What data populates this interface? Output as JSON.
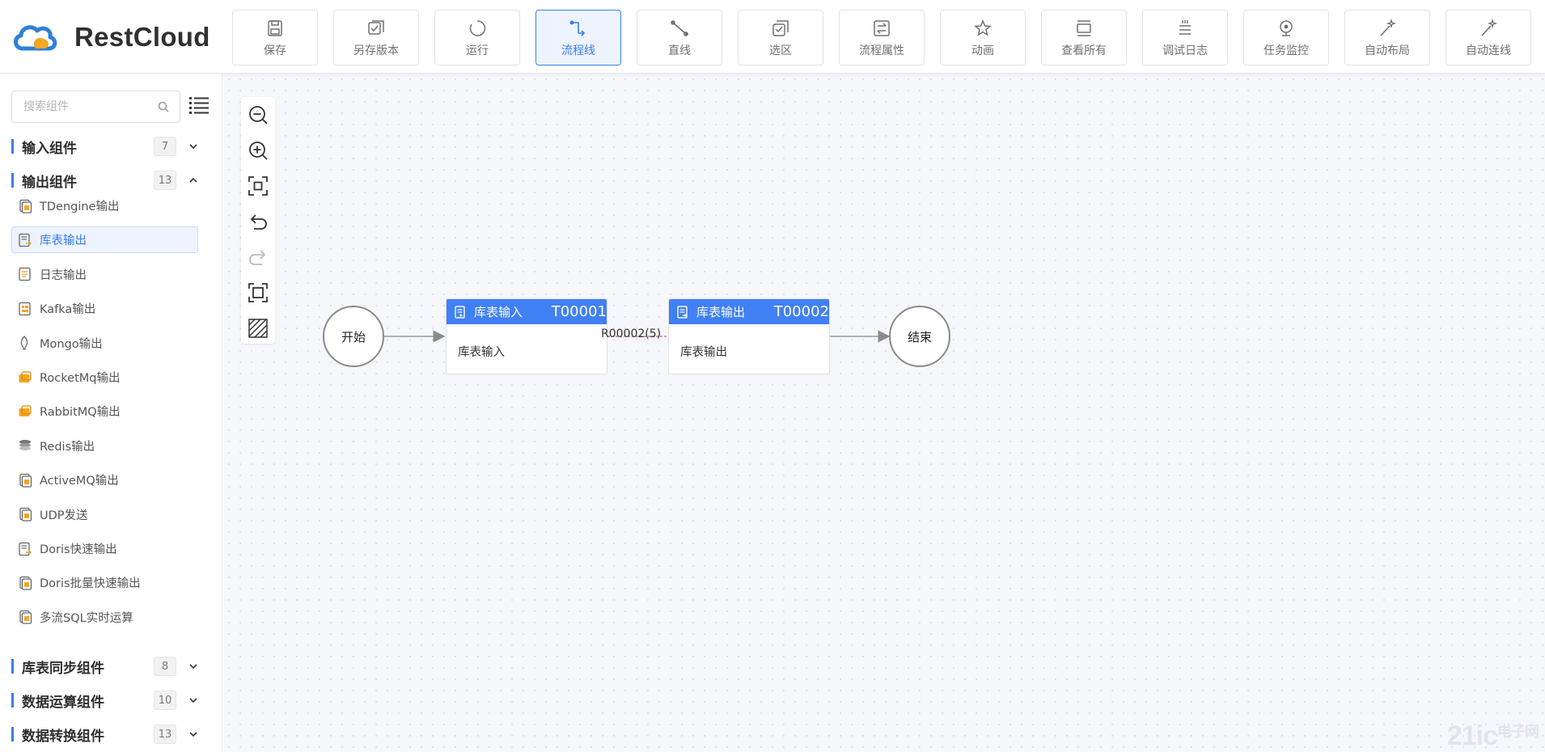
{
  "app": {
    "logo_text": "RestCloud",
    "brand_color": "#3b7cf2"
  },
  "toolbar": [
    {
      "label": "保存",
      "icon": "save-icon"
    },
    {
      "label": "另存版本",
      "icon": "save-version-icon"
    },
    {
      "label": "运行",
      "icon": "run-icon"
    },
    {
      "label": "流程线",
      "icon": "flow-line-icon",
      "active": true
    },
    {
      "label": "直线",
      "icon": "straight-line-icon"
    },
    {
      "label": "选区",
      "icon": "selection-icon"
    },
    {
      "label": "流程属性",
      "icon": "flow-properties-icon"
    },
    {
      "label": "动画",
      "icon": "animation-icon"
    },
    {
      "label": "查看所有",
      "icon": "view-all-icon"
    },
    {
      "label": "调试日志",
      "icon": "debug-log-icon"
    },
    {
      "label": "任务监控",
      "icon": "task-monitor-icon"
    },
    {
      "label": "自动布局",
      "icon": "auto-layout-icon"
    },
    {
      "label": "自动连线",
      "icon": "auto-connect-icon"
    }
  ],
  "sidebar": {
    "search_placeholder": "搜索组件",
    "categories": [
      {
        "label": "输入组件",
        "count": "7",
        "expanded": false
      },
      {
        "label": "输出组件",
        "count": "13",
        "expanded": true
      },
      {
        "label": "库表同步组件",
        "count": "8",
        "expanded": false
      },
      {
        "label": "数据运算组件",
        "count": "10",
        "expanded": false
      },
      {
        "label": "数据转换组件",
        "count": "13",
        "expanded": false
      }
    ],
    "output_components": [
      {
        "label": "TDengine输出",
        "icon": "tdengine-icon"
      },
      {
        "label": "库表输出",
        "icon": "table-output-icon",
        "selected": true
      },
      {
        "label": "日志输出",
        "icon": "log-output-icon"
      },
      {
        "label": "Kafka输出",
        "icon": "kafka-icon"
      },
      {
        "label": "Mongo输出",
        "icon": "mongo-icon"
      },
      {
        "label": "RocketMq输出",
        "icon": "rocketmq-icon"
      },
      {
        "label": "RabbitMQ输出",
        "icon": "rabbitmq-icon"
      },
      {
        "label": "Redis输出",
        "icon": "redis-icon"
      },
      {
        "label": "ActiveMQ输出",
        "icon": "activemq-icon"
      },
      {
        "label": "UDP发送",
        "icon": "udp-icon"
      },
      {
        "label": "Doris快速输出",
        "icon": "doris-icon"
      },
      {
        "label": "Doris批量快速输出",
        "icon": "doris-batch-icon"
      },
      {
        "label": "多流SQL实时运算",
        "icon": "multi-stream-sql-icon"
      }
    ]
  },
  "canvas": {
    "start_label": "开始",
    "end_label": "结束",
    "nodes": [
      {
        "title": "库表输入",
        "id": "T00001",
        "body": "库表输入"
      },
      {
        "title": "库表输出",
        "id": "T00002",
        "body": "库表输出"
      }
    ],
    "edge_label": "R00002(5)"
  },
  "watermark": {
    "text": "21ic",
    "sub": "电子网"
  }
}
